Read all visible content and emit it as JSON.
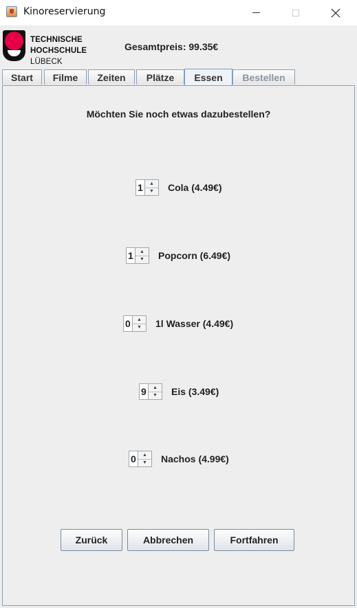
{
  "window": {
    "title": "Kinoreservierung",
    "icon": "java-cup-icon"
  },
  "header": {
    "logo": {
      "line1": "TECHNISCHE",
      "line2": "HOCHSCHULE",
      "line3": "LÜBECK"
    },
    "total_price": "Gesamtpreis: 99.35€"
  },
  "tabs": [
    {
      "label": "Start",
      "state": "normal"
    },
    {
      "label": "Filme",
      "state": "normal"
    },
    {
      "label": "Zeiten",
      "state": "normal"
    },
    {
      "label": "Plätze",
      "state": "normal"
    },
    {
      "label": "Essen",
      "state": "selected"
    },
    {
      "label": "Bestellen",
      "state": "disabled"
    }
  ],
  "main": {
    "question": "Möchten Sie noch etwas dazubestellen?",
    "items": [
      {
        "quantity": "1",
        "label": "Cola (4.49€)"
      },
      {
        "quantity": "1",
        "label": "Popcorn (6.49€)"
      },
      {
        "quantity": "0",
        "label": "1l Wasser (4.49€)"
      },
      {
        "quantity": "9",
        "label": "Eis (3.49€)"
      },
      {
        "quantity": "0",
        "label": "Nachos (4.99€)"
      }
    ]
  },
  "buttons": {
    "back": "Zurück",
    "cancel": "Abbrechen",
    "continue": "Fortfahren"
  }
}
